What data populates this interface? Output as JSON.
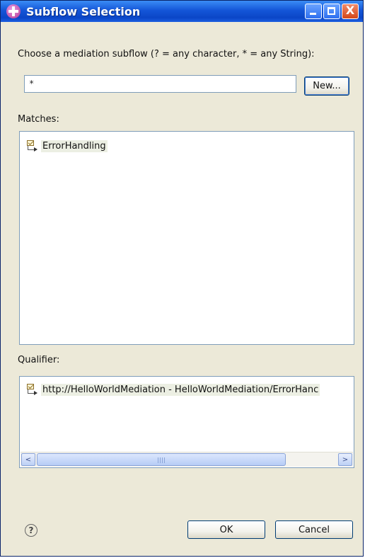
{
  "window": {
    "title": "Subflow Selection"
  },
  "prompt": "Choose a mediation subflow (? = any character, * = any String):",
  "filter": {
    "value": "*"
  },
  "buttons": {
    "new_label": "New...",
    "ok_label": "OK",
    "cancel_label": "Cancel"
  },
  "matches": {
    "label": "Matches:",
    "items": [
      {
        "label": "ErrorHandling",
        "icon": "subflow-icon"
      }
    ]
  },
  "qualifier": {
    "label": "Qualifier:",
    "items": [
      {
        "label": "http://HelloWorldMediation - HelloWorldMediation/ErrorHanc",
        "icon": "subflow-icon"
      }
    ]
  },
  "icons": {
    "help": "?",
    "close": "X",
    "scroll_left": "<",
    "scroll_right": ">"
  }
}
